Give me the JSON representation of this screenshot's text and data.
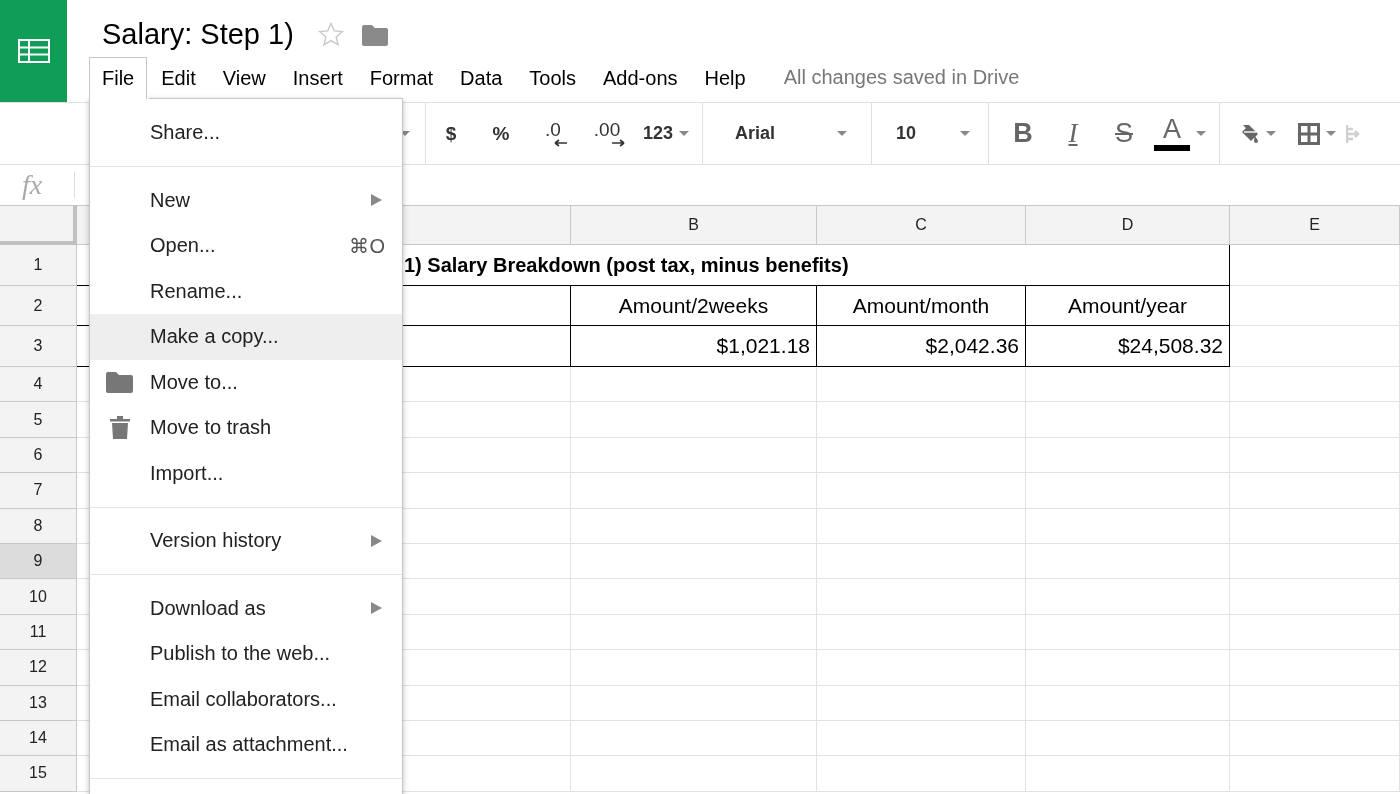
{
  "document": {
    "title": "Salary: Step 1)",
    "starred": false
  },
  "menu_bar": [
    {
      "label": "File",
      "selected": true
    },
    {
      "label": "Edit",
      "selected": false
    },
    {
      "label": "View",
      "selected": false
    },
    {
      "label": "Insert",
      "selected": false
    },
    {
      "label": "Format",
      "selected": false
    },
    {
      "label": "Data",
      "selected": false
    },
    {
      "label": "Tools",
      "selected": false
    },
    {
      "label": "Add-ons",
      "selected": false
    },
    {
      "label": "Help",
      "selected": false
    }
  ],
  "save_status": "All changes saved in Drive",
  "toolbar": [
    {
      "kind": "caret"
    },
    {
      "kind": "sep"
    },
    {
      "kind": "text",
      "label": "$"
    },
    {
      "kind": "text",
      "label": "%"
    },
    {
      "kind": "decrease",
      "label": ".0"
    },
    {
      "kind": "increase",
      "label": ".00"
    },
    {
      "kind": "numfmt",
      "label": "123"
    },
    {
      "kind": "sep"
    },
    {
      "kind": "font",
      "label": "Arial"
    },
    {
      "kind": "sep"
    },
    {
      "kind": "size",
      "label": "10"
    },
    {
      "kind": "sep"
    },
    {
      "kind": "bold",
      "label": "B"
    },
    {
      "kind": "italic",
      "label": "I"
    },
    {
      "kind": "strike",
      "label": "S"
    },
    {
      "kind": "color",
      "label": "A"
    },
    {
      "kind": "sep"
    },
    {
      "kind": "fill"
    },
    {
      "kind": "borders"
    },
    {
      "kind": "merge"
    }
  ],
  "formula_bar": {
    "label": "fx"
  },
  "columns": [
    "B",
    "C",
    "D",
    "E"
  ],
  "row_headers": [
    {
      "label": "1",
      "selected": false
    },
    {
      "label": "2",
      "selected": false
    },
    {
      "label": "3",
      "selected": false
    },
    {
      "label": "4",
      "selected": false
    },
    {
      "label": "5",
      "selected": false
    },
    {
      "label": "6",
      "selected": false
    },
    {
      "label": "7",
      "selected": false
    },
    {
      "label": "8",
      "selected": false
    },
    {
      "label": "9",
      "selected": true
    },
    {
      "label": "10",
      "selected": false
    },
    {
      "label": "11",
      "selected": false
    },
    {
      "label": "12",
      "selected": false
    },
    {
      "label": "13",
      "selected": false
    },
    {
      "label": "14",
      "selected": false
    },
    {
      "label": "15",
      "selected": false
    }
  ],
  "title_cell": "1) Salary Breakdown (post tax, minus benefits)",
  "header_cells": [
    "Amount/2weeks",
    "Amount/month",
    "Amount/year"
  ],
  "value_cells": [
    "$1,021.18",
    "$2,042.36",
    "$24,508.32"
  ],
  "file_menu": [
    {
      "kind": "plain",
      "label": "Share...",
      "selected": false
    },
    {
      "kind": "separator"
    },
    {
      "kind": "submenu",
      "label": "New",
      "selected": false
    },
    {
      "kind": "plain",
      "label": "Open...",
      "shortcut": "⌘O",
      "selected": false
    },
    {
      "kind": "plain",
      "label": "Rename...",
      "selected": false
    },
    {
      "kind": "plain",
      "label": "Make a copy...",
      "selected": true
    },
    {
      "kind": "folder",
      "label": "Move to...",
      "selected": false
    },
    {
      "kind": "trash",
      "label": "Move to trash",
      "selected": false
    },
    {
      "kind": "plain",
      "label": "Import...",
      "selected": false
    },
    {
      "kind": "separator"
    },
    {
      "kind": "submenu",
      "label": "Version history",
      "selected": false
    },
    {
      "kind": "separator"
    },
    {
      "kind": "submenu",
      "label": "Download as",
      "selected": false
    },
    {
      "kind": "plain",
      "label": "Publish to the web...",
      "selected": false
    },
    {
      "kind": "plain",
      "label": "Email collaborators...",
      "selected": false
    },
    {
      "kind": "plain",
      "label": "Email as attachment...",
      "selected": false
    },
    {
      "kind": "separator"
    }
  ]
}
